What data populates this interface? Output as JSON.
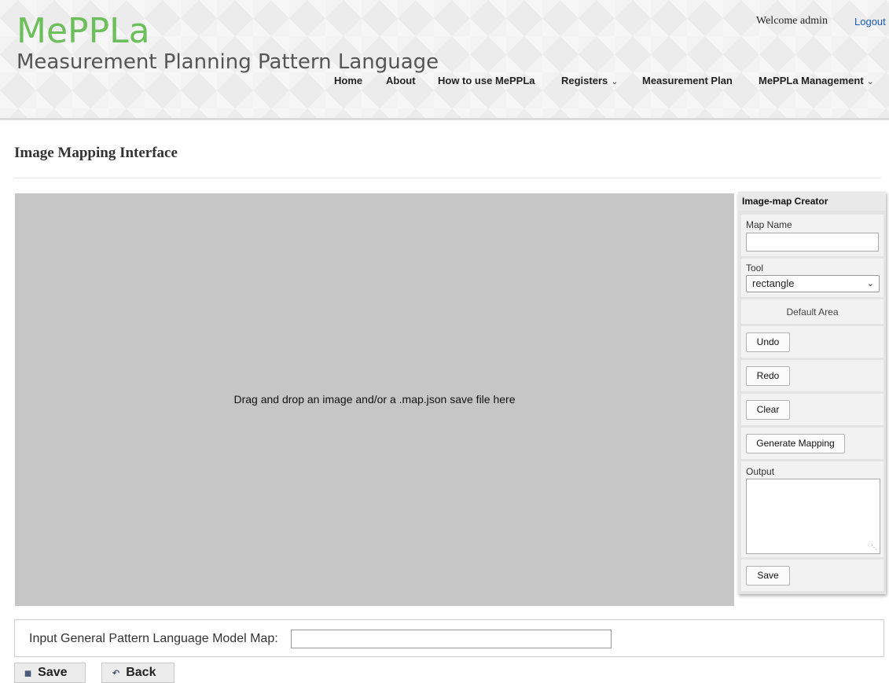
{
  "header": {
    "logo_title": "MePPLa",
    "logo_subtitle": "Measurement Planning Pattern Language",
    "welcome": "Welcome admin",
    "logout": "Logout",
    "nav": {
      "home": "Home",
      "about": "About",
      "howto": "How to use MePPLa",
      "registers": "Registers",
      "measurement_plan": "Measurement Plan",
      "management": "MePPLa Management"
    }
  },
  "page": {
    "title": "Image Mapping Interface"
  },
  "drop_area": {
    "text": "Drag and drop an image and/or a .map.json save file here"
  },
  "panel": {
    "title": "Image-map Creator",
    "map_name_label": "Map Name",
    "map_name_value": "",
    "tool_label": "Tool",
    "tool_value": "rectangle",
    "default_area": "Default Area",
    "undo": "Undo",
    "redo": "Redo",
    "clear": "Clear",
    "generate": "Generate Mapping",
    "output_label": "Output",
    "output_value": "",
    "save": "Save"
  },
  "bottom": {
    "label": "Input General Pattern Language Model Map:",
    "value": "",
    "save": "Save",
    "back": "Back"
  },
  "colors": {
    "brand": "#6cbf5a",
    "link": "#1a5bb8",
    "drop_bg": "#c6c6c6"
  }
}
